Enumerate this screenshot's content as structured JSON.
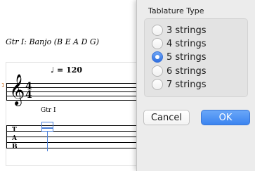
{
  "score": {
    "track_title": "Gtr I: Banjo (B E A D G)",
    "tempo": "♩ = 120",
    "measure_number": "1",
    "time_signature": {
      "top": "4",
      "bottom": "4"
    },
    "track_label": "Gtr I",
    "tab_letters": [
      "T",
      "A",
      "B"
    ]
  },
  "dialog": {
    "title": "Tablature Type",
    "options": [
      {
        "label": "3 strings",
        "selected": false
      },
      {
        "label": "4 strings",
        "selected": false
      },
      {
        "label": "5 strings",
        "selected": true
      },
      {
        "label": "6 strings",
        "selected": false
      },
      {
        "label": "7 strings",
        "selected": false
      }
    ],
    "cancel_label": "Cancel",
    "ok_label": "OK",
    "accent_color": "#3b84f0"
  }
}
